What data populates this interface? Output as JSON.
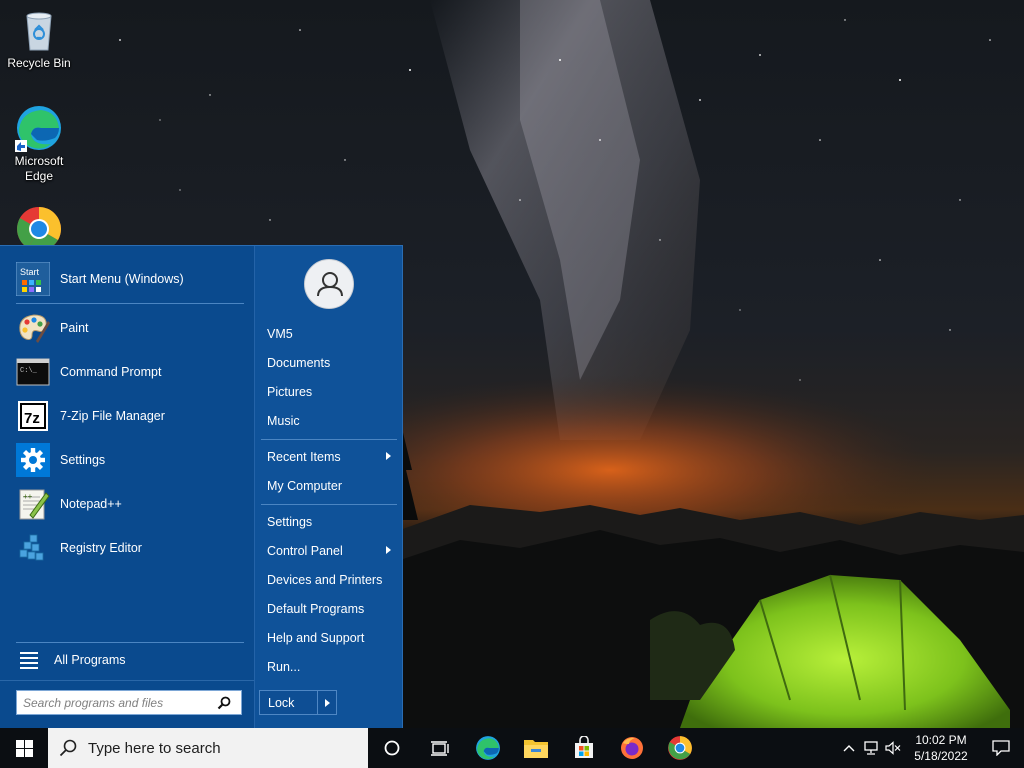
{
  "desktop": {
    "icons": [
      {
        "label": "Recycle Bin",
        "icon": "recycle-bin-icon"
      },
      {
        "label": "Microsoft Edge",
        "icon": "edge-icon"
      },
      {
        "label": "",
        "icon": "chrome-icon"
      }
    ]
  },
  "start_menu": {
    "pinned": [
      {
        "label": "Start Menu (Windows)",
        "icon": "start-menu-icon"
      },
      {
        "label": "Paint",
        "icon": "paint-icon"
      },
      {
        "label": "Command Prompt",
        "icon": "command-prompt-icon"
      },
      {
        "label": "7-Zip File Manager",
        "icon": "7zip-icon"
      },
      {
        "label": "Settings",
        "icon": "settings-gear-icon"
      },
      {
        "label": "Notepad++",
        "icon": "notepadpp-icon"
      },
      {
        "label": "Registry Editor",
        "icon": "registry-editor-icon"
      }
    ],
    "all_programs": "All Programs",
    "search_placeholder": "Search programs and files",
    "right_items": [
      {
        "label": "VM5",
        "submenu": false
      },
      {
        "label": "Documents",
        "submenu": false
      },
      {
        "label": "Pictures",
        "submenu": false
      },
      {
        "label": "Music",
        "submenu": false
      },
      {
        "label": "Recent Items",
        "submenu": true
      },
      {
        "label": "My Computer",
        "submenu": false
      },
      {
        "label": "Settings",
        "submenu": false
      },
      {
        "label": "Control Panel",
        "submenu": true
      },
      {
        "label": "Devices and Printers",
        "submenu": false
      },
      {
        "label": "Default Programs",
        "submenu": false
      },
      {
        "label": "Help and Support",
        "submenu": false
      },
      {
        "label": "Run...",
        "submenu": false
      }
    ],
    "lock_label": "Lock"
  },
  "taskbar": {
    "search_text": "Type here to search",
    "pinned_apps": [
      "cortana-icon",
      "task-view-icon",
      "edge-icon",
      "file-explorer-icon",
      "microsoft-store-icon",
      "firefox-icon",
      "chrome-icon"
    ],
    "clock_time": "10:02 PM",
    "clock_date": "5/18/2022"
  },
  "colors": {
    "start_menu_bg": "#0a4a8e",
    "taskbar_bg": "#0b0e12",
    "accent": "#0078d7"
  }
}
